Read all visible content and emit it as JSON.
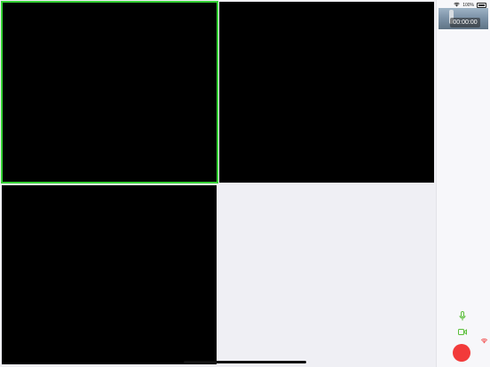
{
  "status_bar": {
    "battery_percent_label": "100%",
    "wifi_icon": "wifi-icon",
    "battery_icon": "battery-icon"
  },
  "self_preview": {
    "timer": "00:00:00"
  },
  "video_grid": {
    "tiles": [
      {
        "id": "participant-1",
        "active_speaker": true
      },
      {
        "id": "participant-2",
        "active_speaker": false
      },
      {
        "id": "participant-3",
        "active_speaker": false
      }
    ]
  },
  "controls": {
    "mic_icon": "microphone-icon",
    "camera_icon": "video-camera-icon",
    "signal_icon": "signal-icon",
    "record_icon": "record-icon"
  },
  "colors": {
    "active_speaker_border": "#35d135",
    "control_green": "#5bbf3a",
    "record_red": "#f23a3a",
    "signal_red": "#f25555",
    "tile_background": "#000000",
    "app_background": "#efeff4"
  }
}
